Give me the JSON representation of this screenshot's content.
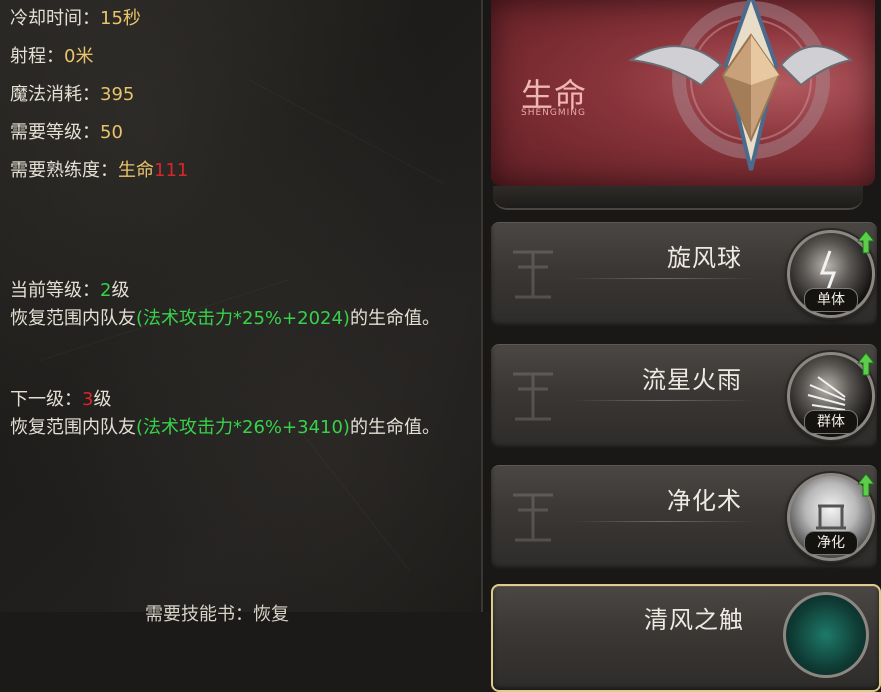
{
  "details": {
    "cooldown_label": "冷却时间：",
    "cooldown_value": "15秒",
    "range_label": "射程：",
    "range_value": "0米",
    "mana_label": "魔法消耗：",
    "mana_value": "395",
    "level_req_label": "需要等级：",
    "level_req_value": "50",
    "proficiency_label": "需要熟练度：",
    "proficiency_school": "生命",
    "proficiency_value": "111",
    "current_level_label": "当前等级：",
    "current_level_value": "2",
    "current_level_unit": "级",
    "current_effect_pre": "恢复范围内队友",
    "current_effect_formula": "(法术攻击力*25%+2024)",
    "current_effect_post": "的生命值。",
    "next_level_label": "下一级：",
    "next_level_value": "3",
    "next_level_unit": "级",
    "next_effect_pre": "恢复范围内队友",
    "next_effect_formula": "(法术攻击力*26%+3410)",
    "next_effect_post": "的生命值。",
    "bottom_partial": "需要技能书：恢复"
  },
  "banner": {
    "school_title": "生命",
    "school_pinyin": "SHENGMING"
  },
  "skills": [
    {
      "name": "旋风球",
      "tag": "单体",
      "icon": "lightning-skill-icon"
    },
    {
      "name": "流星火雨",
      "tag": "群体",
      "icon": "meteor-skill-icon"
    },
    {
      "name": "净化术",
      "tag": "净化",
      "icon": "purify-skill-icon"
    },
    {
      "name": "清风之触",
      "tag": "",
      "icon": "heal-skill-icon"
    }
  ],
  "colors": {
    "gold": "#e8c46a",
    "green": "#37d24a",
    "red": "#d8262a",
    "banner_red": "#8a343b"
  }
}
